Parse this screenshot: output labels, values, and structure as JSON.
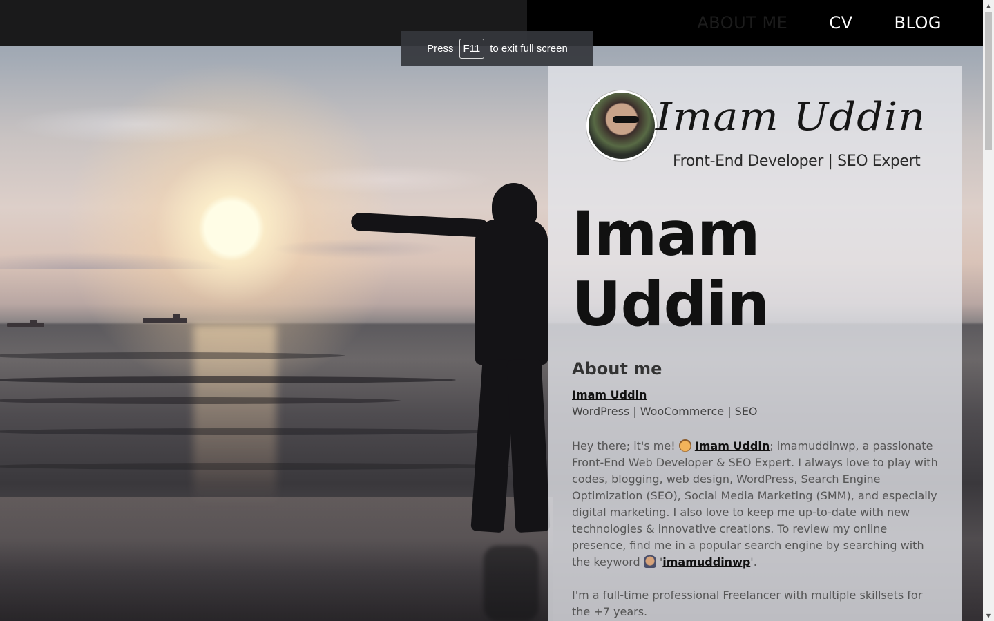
{
  "nav": {
    "items": [
      {
        "label": "ABOUT ME",
        "active": true
      },
      {
        "label": "CV",
        "active": false
      },
      {
        "label": "BLOG",
        "active": false
      }
    ]
  },
  "toast": {
    "before": "Press",
    "key": "F11",
    "after": "to exit full screen"
  },
  "logo": {
    "signature": "Imam Uddin",
    "tagline": "Front-End Developer | SEO Expert"
  },
  "hero": {
    "title_line1": "Imam",
    "title_line2": "Uddin"
  },
  "about": {
    "heading": "About me",
    "name_link": "Imam Uddin",
    "subtitle": "WordPress | WooCommerce | SEO",
    "p1_start": "Hey there; it's me! ",
    "p1_link1": "Imam Uddin",
    "p1_middle": "; imamuddinwp, a passionate Front-End Web Developer & SEO Expert. I always love to play with codes, blogging, web design, WordPress, Search Engine Optimization (SEO), Social Media Marketing (SMM), and especially digital marketing. I also love to keep me up-to-date with new technologies & innovative creations. To review my online presence, find me in a popular search engine by searching with the keyword ",
    "p1_quote_open": "'",
    "p1_link2": "imamuddinwp",
    "p1_end": "'.",
    "p2": "I'm a full-time professional Freelancer with multiple skillsets for the +7 years."
  },
  "colors": {
    "topbar": "#000000",
    "panel": "#e4e6ea",
    "title": "#111111",
    "nav_text": "#ffffff"
  },
  "icons": {
    "emoji1": "cowboy-face-icon",
    "emoji2": "detective-icon"
  }
}
